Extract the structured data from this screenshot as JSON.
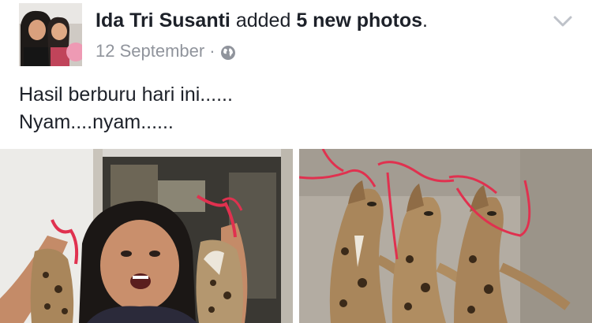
{
  "post": {
    "author": "Ida Tri Susanti",
    "action": "added",
    "photo_count_text": "5 new photos",
    "punctuation": ".",
    "date": "12 September",
    "separator": "·",
    "privacy_icon": "globe-icon",
    "menu_icon": "chevron-down-icon",
    "caption_lines": [
      "Hasil berburu hari ini......",
      "Nyam....nyam......"
    ]
  },
  "photos": [
    {
      "name": "photo-woman-holding-leopard-cats"
    },
    {
      "name": "photo-three-leopard-cats-on-ground"
    }
  ],
  "colors": {
    "text": "#1d2129",
    "meta": "#90949c",
    "ribbon": "#e0314f",
    "fur": "#a9865b"
  }
}
